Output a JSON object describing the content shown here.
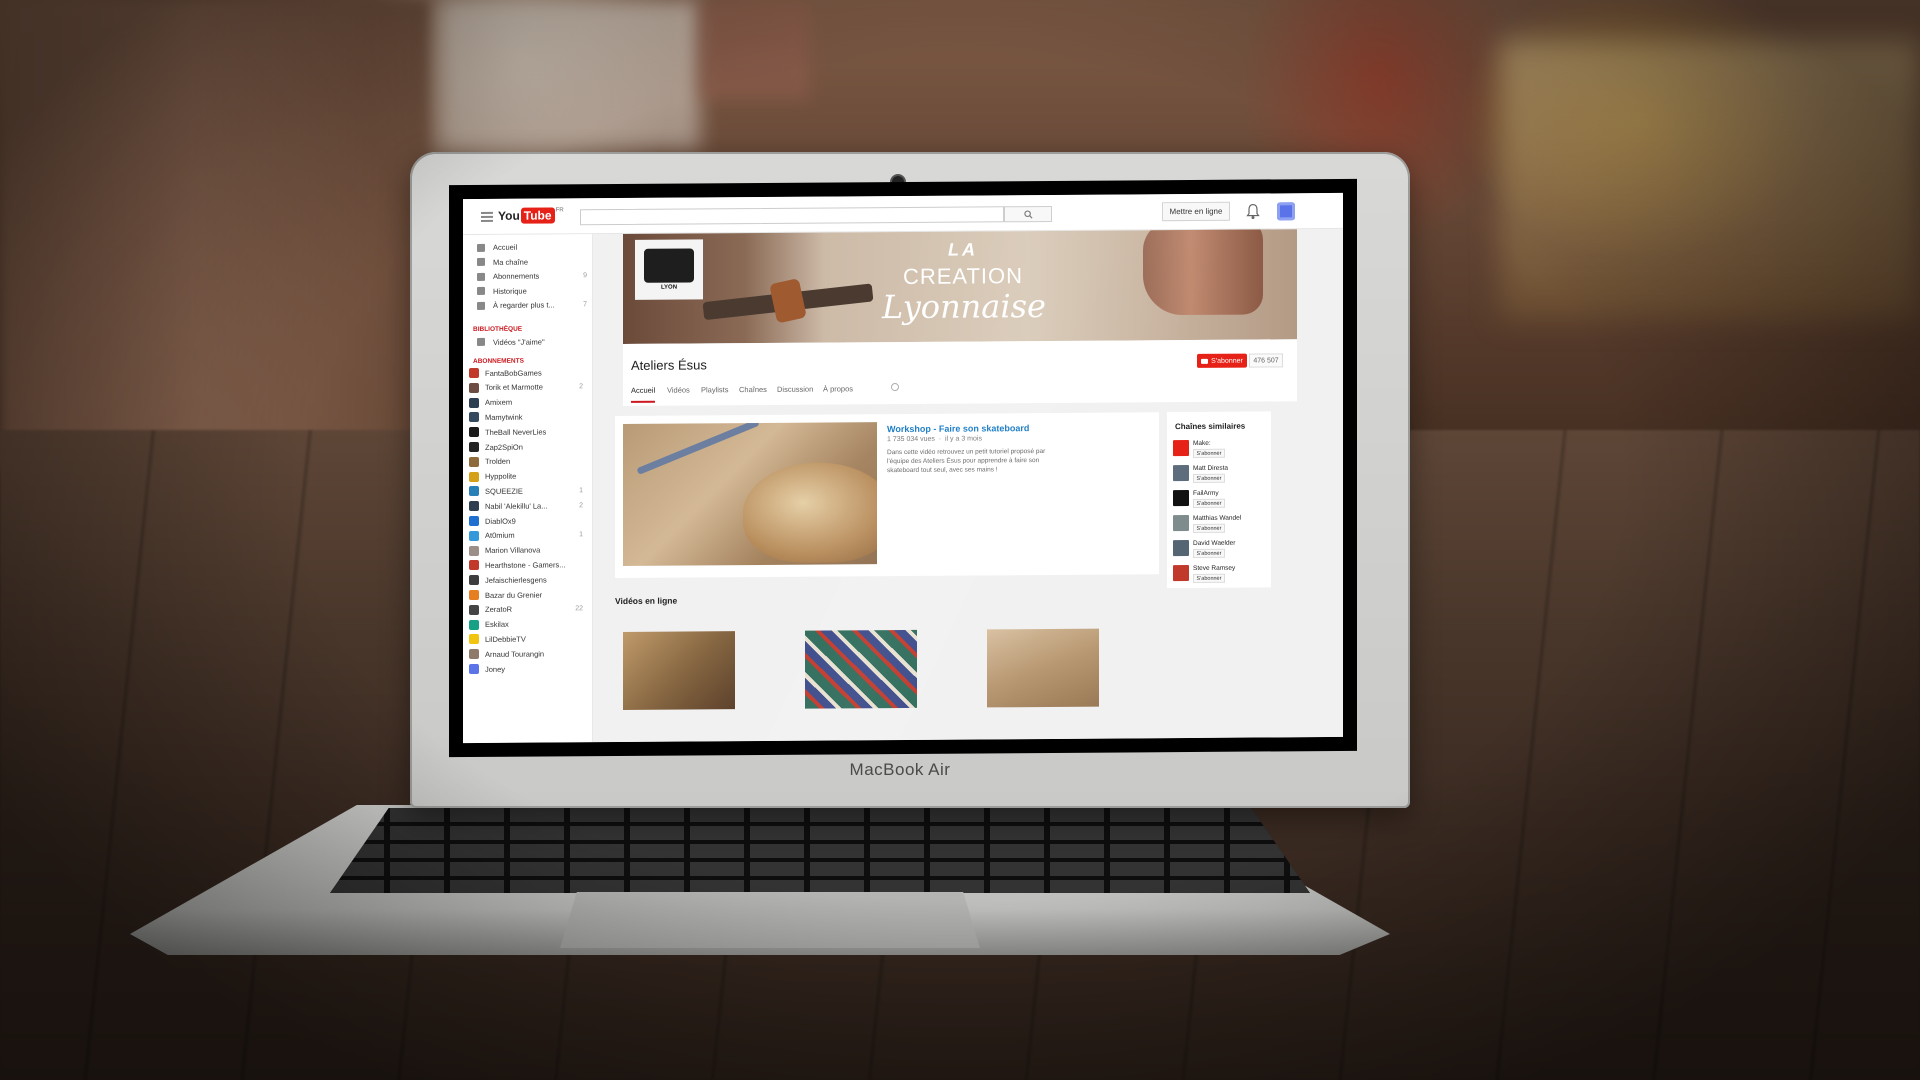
{
  "laptop": {
    "brand": "MacBook Air"
  },
  "topbar": {
    "logo_you": "You",
    "logo_tube": "Tube",
    "logo_region": "FR",
    "search_placeholder": "",
    "upload_label": "Mettre en ligne"
  },
  "sidebar": {
    "nav": [
      {
        "label": "Accueil",
        "icon": "home-icon",
        "count": ""
      },
      {
        "label": "Ma chaîne",
        "icon": "user-icon",
        "count": ""
      },
      {
        "label": "Abonnements",
        "icon": "subscriptions-icon",
        "count": "9"
      },
      {
        "label": "Historique",
        "icon": "history-icon",
        "count": ""
      },
      {
        "label": "À regarder plus t...",
        "icon": "clock-icon",
        "count": "7"
      }
    ],
    "library_heading": "BIBLIOTHÈQUE",
    "library": [
      {
        "label": "Vidéos \"J'aime\"",
        "icon": "like-icon"
      }
    ],
    "subscriptions_heading": "ABONNEMENTS",
    "subscriptions": [
      {
        "label": "FantaBobGames",
        "count": "",
        "color": "#c0392b"
      },
      {
        "label": "Torik et Marmotte",
        "count": "2",
        "color": "#6d4c41"
      },
      {
        "label": "Amixem",
        "count": "",
        "color": "#2c3e50"
      },
      {
        "label": "Mamytwink",
        "count": "",
        "color": "#34495e"
      },
      {
        "label": "TheBall NeverLies",
        "count": "",
        "color": "#1a1a1a"
      },
      {
        "label": "Zap2SpiOn",
        "count": "",
        "color": "#222222"
      },
      {
        "label": "Trolden",
        "count": "",
        "color": "#8e6b3a"
      },
      {
        "label": "Hyppolite",
        "count": "",
        "color": "#d4a017"
      },
      {
        "label": "SQUEEZIE",
        "count": "1",
        "color": "#2980b9"
      },
      {
        "label": "Nabil 'Alekillu' La...",
        "count": "2",
        "color": "#2c3e50"
      },
      {
        "label": "DiablOx9",
        "count": "",
        "color": "#1f6fd1"
      },
      {
        "label": "At0mium",
        "count": "1",
        "color": "#3498db"
      },
      {
        "label": "Marion Villanova",
        "count": "",
        "color": "#9b8f87"
      },
      {
        "label": "Hearthstone - Gamers...",
        "count": "",
        "color": "#c0392b"
      },
      {
        "label": "Jefaischierlesgens",
        "count": "",
        "color": "#3d3d3d"
      },
      {
        "label": "Bazar du Grenier",
        "count": "",
        "color": "#e67e22"
      },
      {
        "label": "ZeratoR",
        "count": "22",
        "color": "#444444"
      },
      {
        "label": "Eskilax",
        "count": "",
        "color": "#16a085"
      },
      {
        "label": "LilDebbieTV",
        "count": "",
        "color": "#f1c40f"
      },
      {
        "label": "Arnaud Tourangin",
        "count": "",
        "color": "#8e7a6a"
      },
      {
        "label": "Joney",
        "count": "",
        "color": "#5a73e8"
      }
    ]
  },
  "banner": {
    "logo_text": "LYON",
    "line1": "LA",
    "line2": "CREATION",
    "line3": "Lyonnaise"
  },
  "channel": {
    "title": "Ateliers Ésus",
    "subscribe_label": "S'abonner",
    "subscriber_count": "476 507",
    "tabs": [
      "Accueil",
      "Vidéos",
      "Playlists",
      "Chaînes",
      "Discussion",
      "À propos"
    ]
  },
  "featured": {
    "title": "Workshop - Faire son skateboard",
    "views": "1 735 034 vues",
    "age": "il y a 3 mois",
    "description": "Dans cette vidéo retrouvez un petit tutoriel proposé par l'équipe des Ateliers Ésus pour apprendre à faire son skateboard tout seul, avec ses mains !"
  },
  "section": {
    "uploads_title": "Vidéos en ligne"
  },
  "related": {
    "title": "Chaînes similaires",
    "channels": [
      {
        "name": "Make:",
        "button": "S'abonner",
        "color": "#e62117"
      },
      {
        "name": "Matt Diresta",
        "button": "S'abonner",
        "color": "#5d6d7e"
      },
      {
        "name": "FailArmy",
        "button": "S'abonner",
        "color": "#111111"
      },
      {
        "name": "Matthias Wandel",
        "button": "S'abonner",
        "color": "#7f8c8d"
      },
      {
        "name": "David Waelder",
        "button": "S'abonner",
        "color": "#566573"
      },
      {
        "name": "Steve Ramsey",
        "button": "S'abonner",
        "color": "#c0392b"
      }
    ]
  },
  "colors": {
    "accent_red": "#e62117",
    "link_blue": "#167ac6"
  }
}
